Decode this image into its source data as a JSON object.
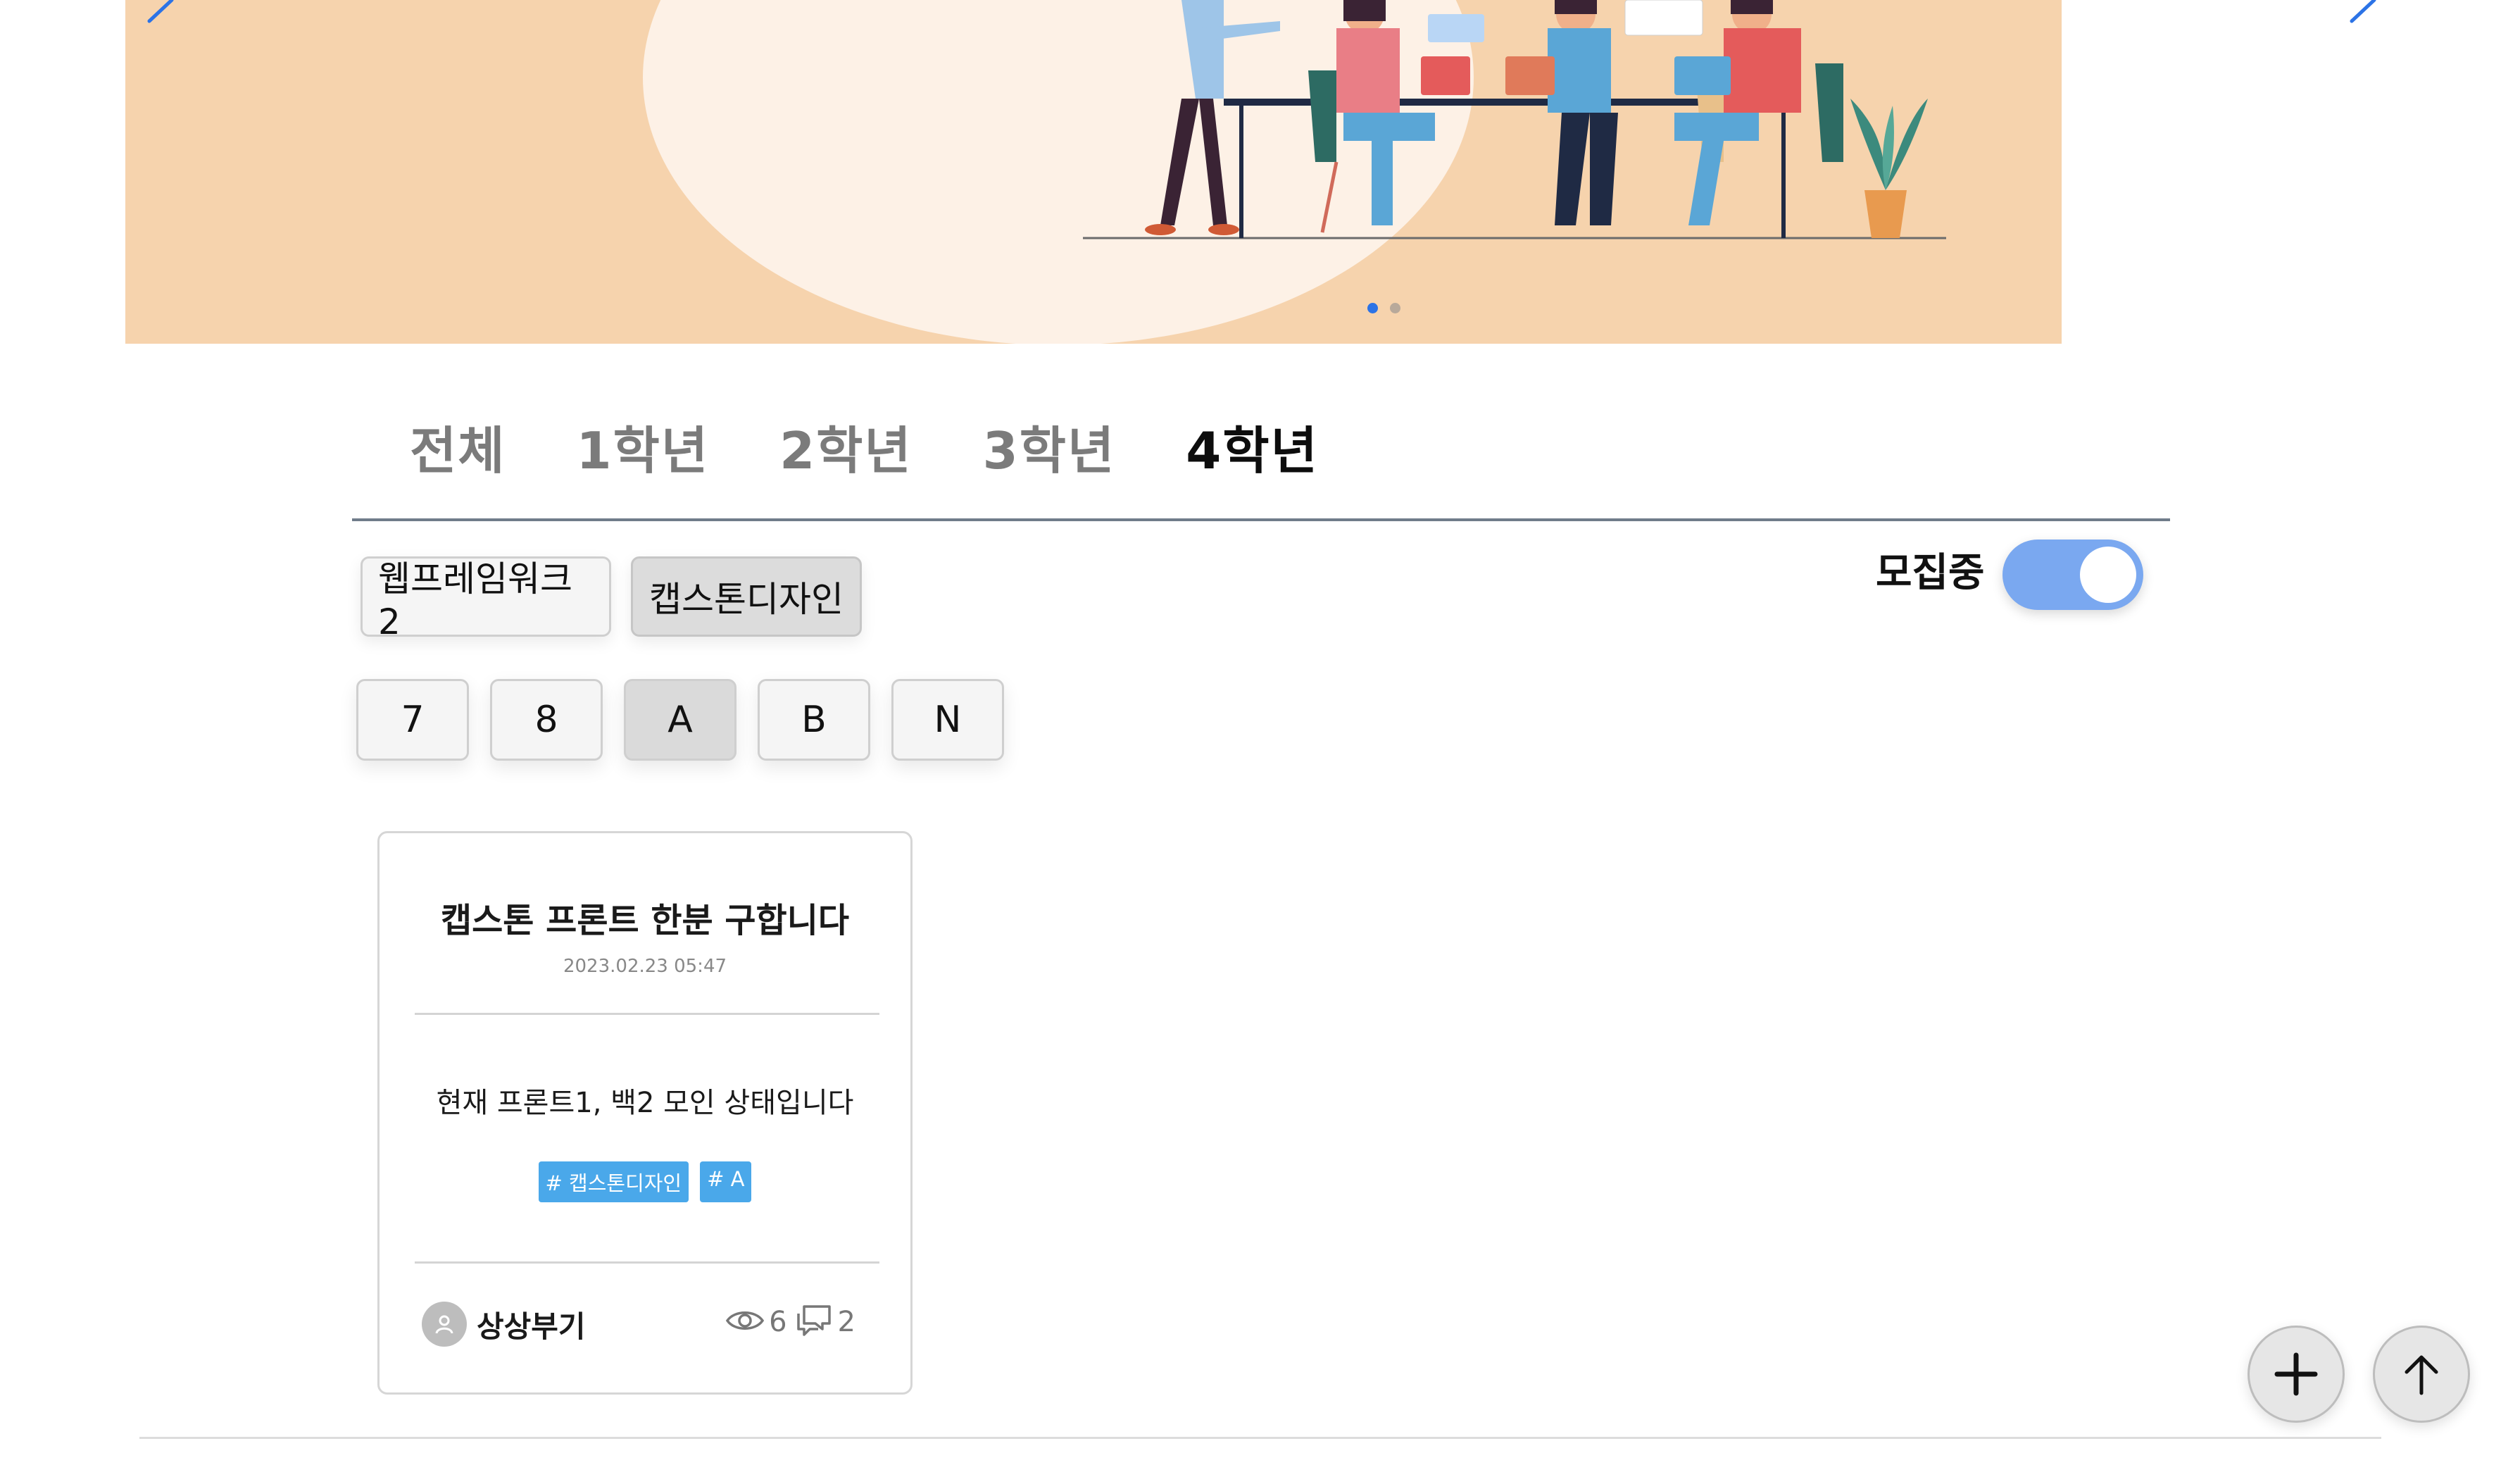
{
  "banner": {
    "slides_total": 2,
    "active_slide": 1,
    "colors": {
      "background": "#f6d3ad",
      "accent": "#2c73e6"
    }
  },
  "grade_tabs": [
    {
      "label": "전체",
      "active": false
    },
    {
      "label": "1학년",
      "active": false
    },
    {
      "label": "2학년",
      "active": false
    },
    {
      "label": "3학년",
      "active": false
    },
    {
      "label": "4학년",
      "active": true
    }
  ],
  "subjects": [
    {
      "label": "웹프레임워크2",
      "selected": false
    },
    {
      "label": "캡스톤디자인",
      "selected": true
    }
  ],
  "classes": [
    {
      "label": "7",
      "selected": false
    },
    {
      "label": "8",
      "selected": false
    },
    {
      "label": "A",
      "selected": true
    },
    {
      "label": "B",
      "selected": false
    },
    {
      "label": "N",
      "selected": false
    }
  ],
  "recruiting": {
    "label": "모집중",
    "on": true
  },
  "posts": [
    {
      "title": "캡스톤 프론트 한분 구합니다",
      "date": "2023.02.23 05:47",
      "body": "현재 프론트1, 백2 모인 상태입니다",
      "tags": [
        "# 캡스톤디자인",
        "# A"
      ],
      "author": "상상부기",
      "views": "6",
      "comments": "2"
    }
  ],
  "icons": {
    "banner_prev": "chevron-left-icon",
    "banner_next": "chevron-right-icon",
    "avatar": "user-icon",
    "views": "eye-icon",
    "comments": "comment-icon",
    "add": "plus-icon",
    "scroll_top": "arrow-up-icon"
  }
}
